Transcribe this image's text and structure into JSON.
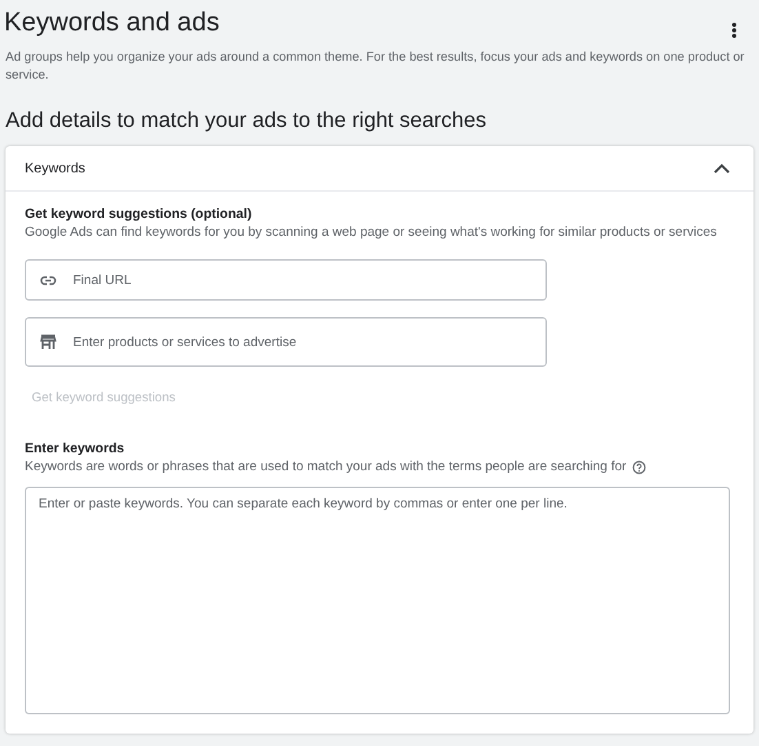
{
  "page": {
    "title": "Keywords and ads",
    "description": "Ad groups help you organize your ads around a common theme. For the best results, focus your ads and keywords on one product or service."
  },
  "section_title": "Add details to match your ads to the right searches",
  "panel": {
    "title": "Keywords",
    "expanded": true,
    "suggestions": {
      "heading": "Get keyword suggestions (optional)",
      "description": "Google Ads can find keywords for you by scanning a web page or seeing what's working for similar products or services",
      "fields": [
        {
          "kind": "link",
          "placeholder": "Final URL"
        },
        {
          "kind": "store",
          "placeholder": "Enter products or services to advertise"
        }
      ],
      "button": {
        "label": "Get keyword suggestions",
        "disabled": true
      }
    },
    "keywords": {
      "heading": "Enter keywords",
      "description": "Keywords are words or phrases that are used to match your ads with the terms people are searching for",
      "placeholder": "Enter or paste keywords. You can separate each keyword by commas or enter one per line."
    }
  }
}
